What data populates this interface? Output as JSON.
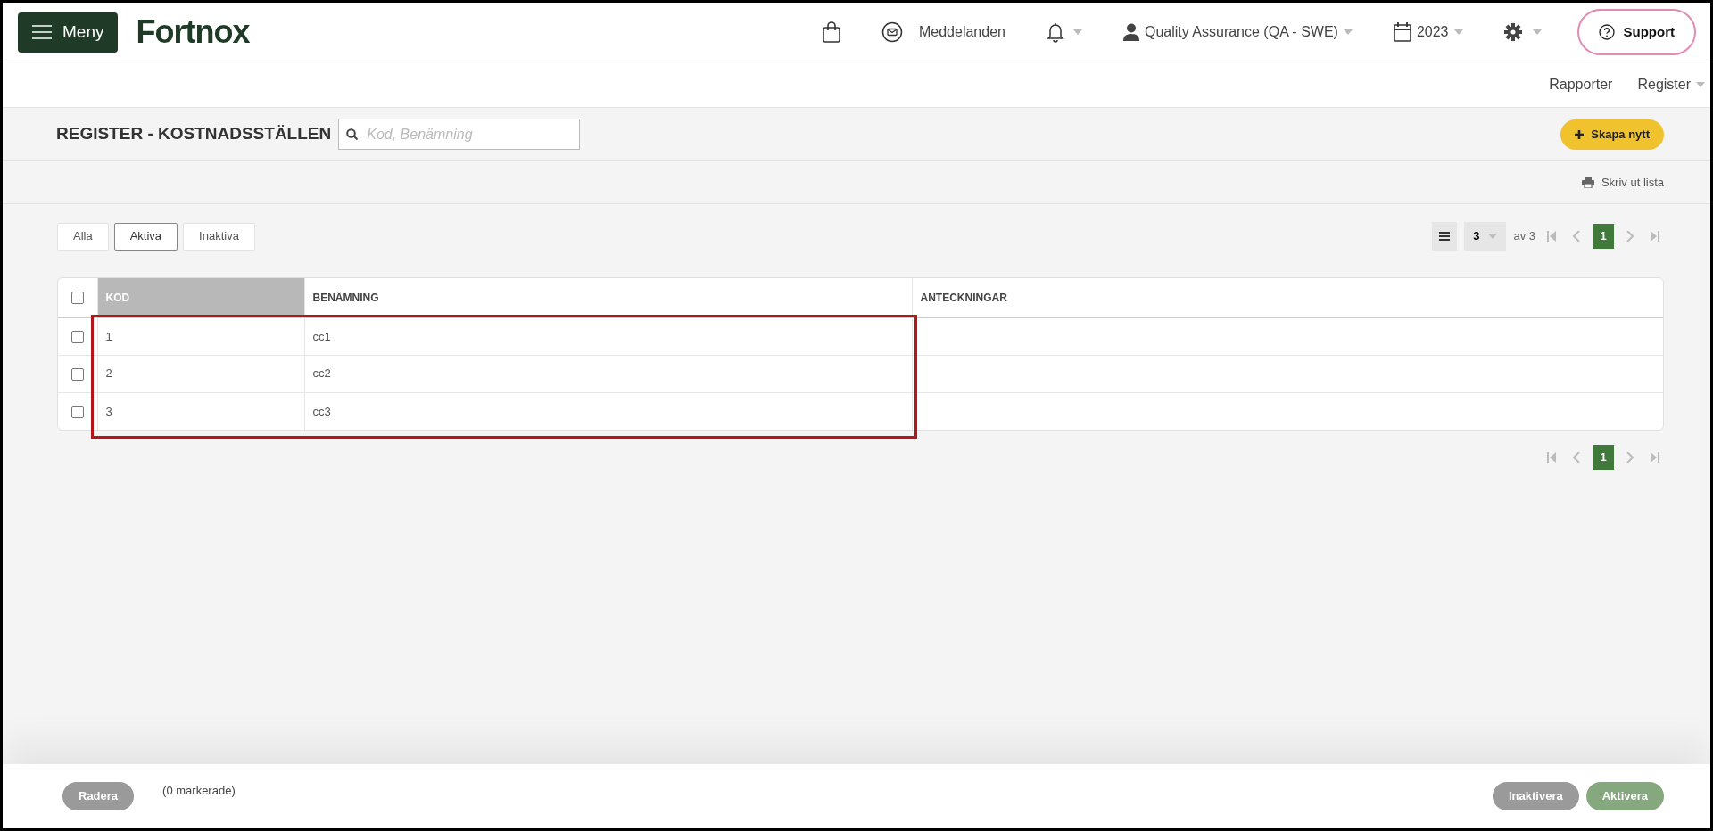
{
  "top_bar": {
    "menu_button": "Meny",
    "logo": "Fortnox",
    "messages": "Meddelanden",
    "notifications": {
      "has_dropdown": true
    },
    "user": {
      "label": "Quality Assurance (QA - SWE)",
      "has_dropdown": true
    },
    "year": {
      "label": "2023",
      "has_dropdown": true
    },
    "settings": {
      "has_dropdown": true
    },
    "support": "Support"
  },
  "sub_nav": [
    {
      "label": "Rapporter",
      "has_dropdown": false
    },
    {
      "label": "Register",
      "has_dropdown": true
    }
  ],
  "page": {
    "title": "REGISTER - KOSTNADSSTÄLLEN",
    "search": {
      "placeholder": "Kod, Benämning"
    },
    "create_button": "Skapa nytt",
    "print_link": "Skriv ut lista"
  },
  "filters": [
    {
      "label": "Alla",
      "selected": false
    },
    {
      "label": "Aktiva",
      "selected": true
    },
    {
      "label": "Inaktiva",
      "selected": false
    }
  ],
  "pagination": {
    "page_size": "3",
    "total": "av 3",
    "pages": [
      {
        "label": "1",
        "selected": true
      }
    ]
  },
  "table": {
    "select_all_checked": false,
    "columns": [
      {
        "label": "KOD",
        "sorted": true
      },
      {
        "label": "BENÄMNING",
        "sorted": false
      },
      {
        "label": "ANTECKNINGAR",
        "sorted": false
      }
    ],
    "rows": [
      {
        "checked": false,
        "cells": [
          "1",
          "cc1"
        ]
      },
      {
        "checked": false,
        "cells": [
          "2",
          "cc2"
        ]
      },
      {
        "checked": false,
        "cells": [
          "3",
          "cc3"
        ]
      }
    ]
  },
  "bottom_pagination": {
    "pages": [
      {
        "label": "1",
        "selected": true
      }
    ]
  },
  "footer": {
    "delete_button": {
      "label": "Radera",
      "disabled": true
    },
    "selection_count": "(0 markerade)",
    "deactivate_button": {
      "label": "Inaktivera",
      "disabled": true
    },
    "activate_button": {
      "label": "Aktivera",
      "disabled": true
    }
  }
}
